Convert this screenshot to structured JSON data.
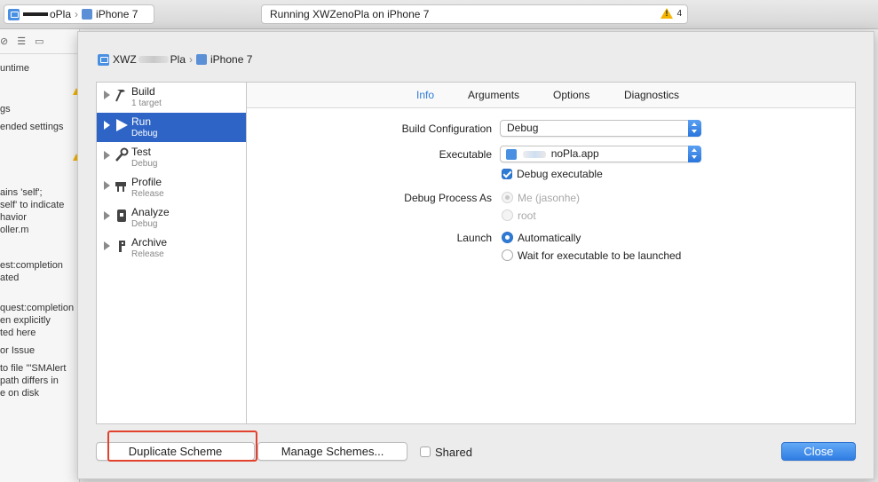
{
  "toolbar": {
    "scheme_name_visible": "oPla",
    "device": "iPhone 7",
    "activity_status": "Running XWZenoPla on iPhone 7",
    "warning_count": "4"
  },
  "navigator": {
    "lines": [
      "untime",
      "gs",
      "ended settings",
      "ains 'self';",
      "self' to indicate",
      "havior",
      "oller.m",
      "est:completion",
      "ated",
      "quest:completion",
      "en explicitly",
      "ted here",
      "or Issue",
      "to file '\"SMAlert",
      "path differs in",
      "e on disk"
    ]
  },
  "sheet": {
    "breadcrumb": {
      "project": "XWZ",
      "project_tail": "Pla",
      "device": "iPhone 7"
    },
    "actions": [
      {
        "name": "Build",
        "sub": "1 target",
        "icon": "hammer-icon"
      },
      {
        "name": "Run",
        "sub": "Debug",
        "icon": "play-icon"
      },
      {
        "name": "Test",
        "sub": "Debug",
        "icon": "wrench-icon"
      },
      {
        "name": "Profile",
        "sub": "Release",
        "icon": "instruments-icon"
      },
      {
        "name": "Analyze",
        "sub": "Debug",
        "icon": "analyze-icon"
      },
      {
        "name": "Archive",
        "sub": "Release",
        "icon": "archive-icon"
      }
    ],
    "selected_action": "Run",
    "tabs": [
      "Info",
      "Arguments",
      "Options",
      "Diagnostics"
    ],
    "active_tab": "Info",
    "form": {
      "build_config_label": "Build Configuration",
      "build_config_value": "Debug",
      "executable_label": "Executable",
      "executable_value": "noPla.app",
      "debug_exec_label": "Debug executable",
      "debug_exec_checked": true,
      "debug_process_label": "Debug Process As",
      "debug_process_me": "Me (jasonhe)",
      "debug_process_root": "root",
      "launch_label": "Launch",
      "launch_auto": "Automatically",
      "launch_wait": "Wait for executable to be launched"
    },
    "footer": {
      "duplicate": "Duplicate Scheme",
      "manage": "Manage Schemes...",
      "shared": "Shared",
      "close": "Close"
    }
  },
  "colors": {
    "accent": "#2e7bd6",
    "selection": "#2e64c5",
    "highlight": "#e2412e",
    "warning": "#f5b400"
  }
}
